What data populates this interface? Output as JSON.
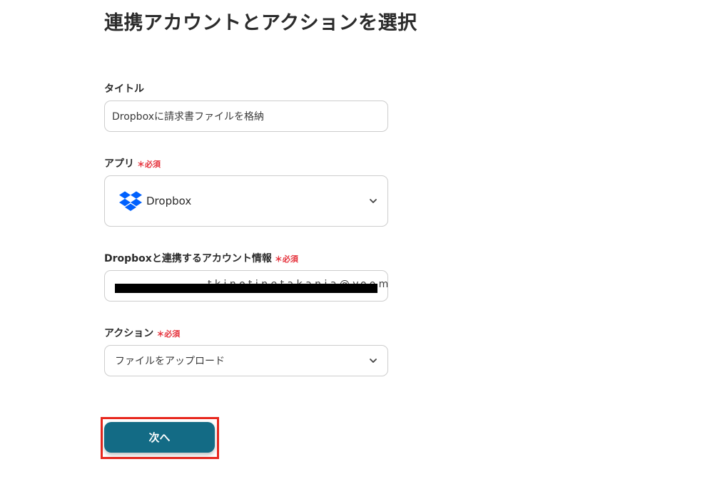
{
  "page": {
    "title": "連携アカウントとアクションを選択"
  },
  "fields": {
    "title": {
      "label": "タイトル",
      "value": "Dropboxに請求書ファイルを格納"
    },
    "app": {
      "label": "アプリ",
      "required": "＊必須",
      "value": "Dropbox",
      "icon": "dropbox-logo-icon"
    },
    "account": {
      "label": "Dropboxと連携するアカウント情報",
      "required": "＊必須",
      "value": "t.k.i.n.o.t.i.n.e.t.a.k.a.n.i.a.@.y.o.o.m.e.f.e"
    },
    "action": {
      "label": "アクション",
      "required": "＊必須",
      "value": "ファイルをアップロード"
    }
  },
  "footer": {
    "next_label": "次へ"
  },
  "colors": {
    "accent": "#136b85",
    "required": "#e5313b",
    "highlight": "#e8281e",
    "dropbox_blue": "#0061fe"
  }
}
